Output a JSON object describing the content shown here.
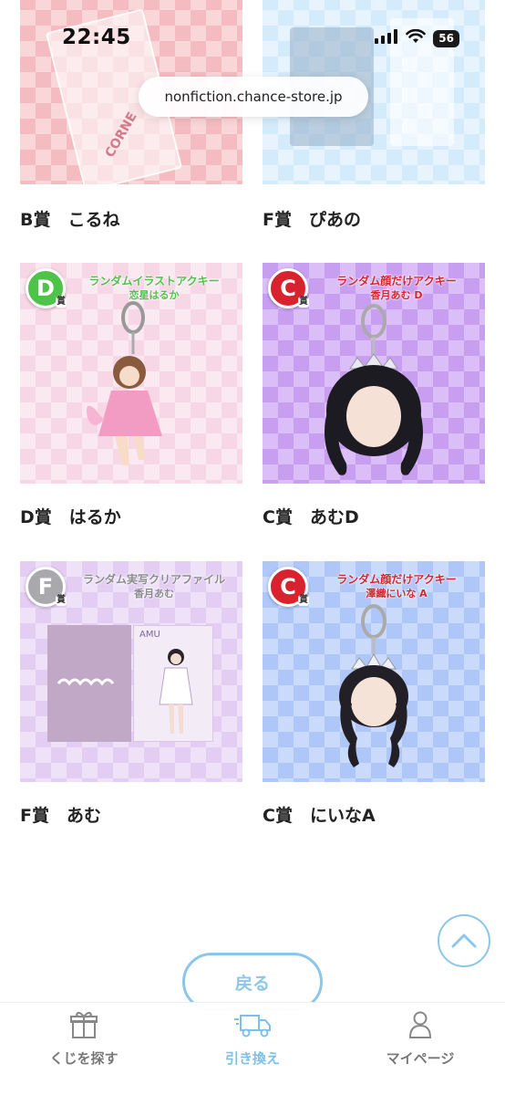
{
  "status_bar": {
    "time": "22:45",
    "battery": "56"
  },
  "browser": {
    "url": "nonfiction.chance-store.jp"
  },
  "prizes": [
    {
      "caption": "B賞　こるね",
      "logo_text": "CORNE"
    },
    {
      "caption": "F賞　ぴあの"
    },
    {
      "caption": "D賞　はるか",
      "badge": "D",
      "badge_suffix": "賞",
      "title": "ランダムイラストアクキー",
      "subtitle": "恋星はるか"
    },
    {
      "caption": "C賞　あむD",
      "badge": "C",
      "badge_suffix": "賞",
      "title": "ランダム顔だけアクキー",
      "subtitle": "香月あむ D"
    },
    {
      "caption": "F賞　あむ",
      "badge": "F",
      "badge_suffix": "賞",
      "title": "ランダム実写クリアファイル",
      "subtitle": "香月あむ",
      "card_text": "AMU"
    },
    {
      "caption": "C賞　にいなA",
      "badge": "C",
      "badge_suffix": "賞",
      "title": "ランダム顔だけアクキー",
      "subtitle": "澤織にいな A"
    }
  ],
  "actions": {
    "back_label": "戻る"
  },
  "tab_bar": {
    "tabs": [
      {
        "label": "くじを探す",
        "icon": "gift-icon"
      },
      {
        "label": "引き換え",
        "icon": "delivery-truck-icon",
        "active": true
      },
      {
        "label": "マイページ",
        "icon": "person-icon"
      }
    ]
  },
  "colors": {
    "accent": "#7fc0e8",
    "badge_green": "#4fc24a",
    "badge_red": "#d8232f",
    "badge_silver": "#a9a9ad"
  }
}
